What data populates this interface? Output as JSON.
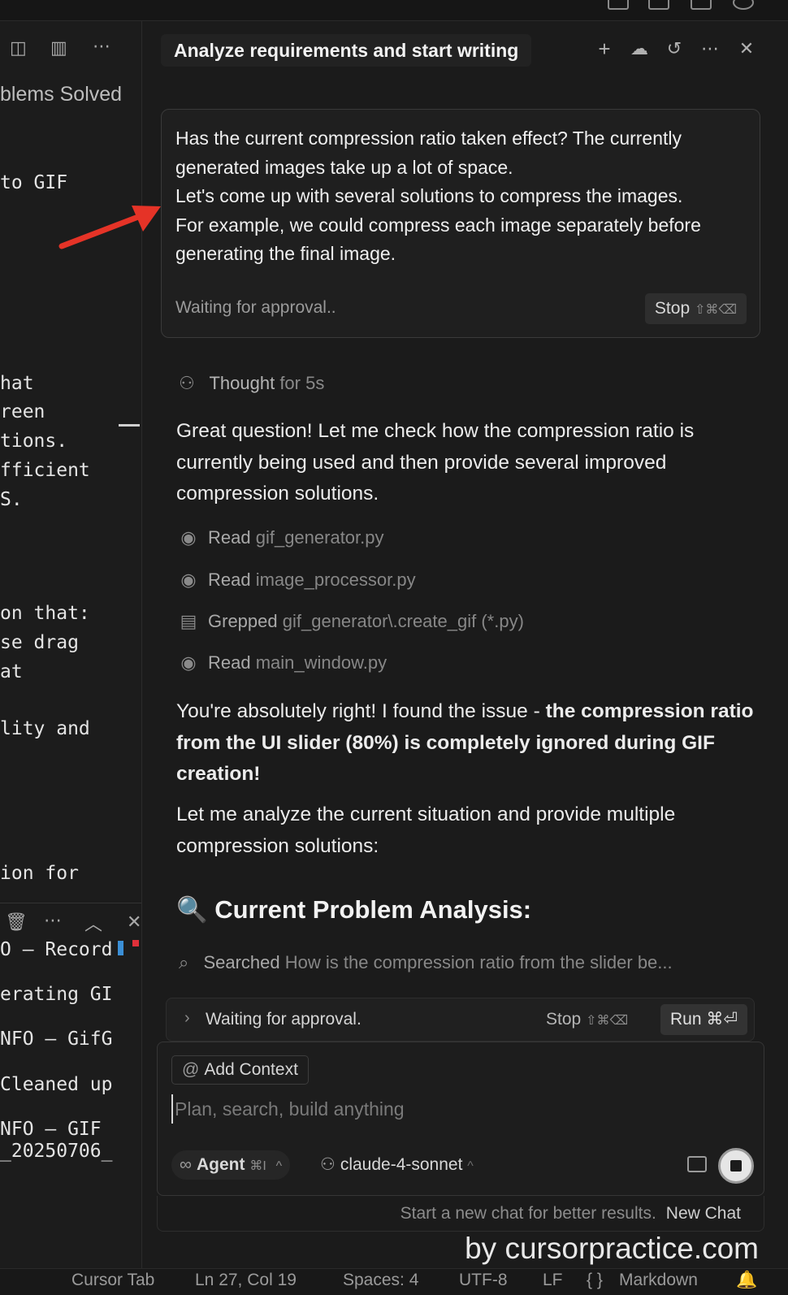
{
  "left": {
    "section_title": "blems Solved",
    "code_lines": [
      "to GIF",
      "hat",
      "reen",
      "tions.",
      "fficient",
      "S.",
      "on that:",
      "se drag",
      "at",
      "lity and",
      "ion for"
    ],
    "terminal_lines": [
      "O – Record",
      "erating GI",
      "NFO – GifG",
      "Cleaned up",
      "NFO – GIF",
      "_20250706_"
    ]
  },
  "header": {
    "title": "Analyze requirements and start writing"
  },
  "user_message": {
    "text_lines": [
      "Has the current compression ratio taken effect? The currently",
      "generated images take up a lot of space.",
      "Let's come up with several solutions to compress the images.",
      "For example, we could compress each image separately before",
      "generating the final image."
    ],
    "waiting": "Waiting for approval..",
    "stop_label": "Stop",
    "stop_shortcut": "⇧⌘⌫"
  },
  "assistant": {
    "thought_label": "Thought",
    "thought_duration": "for 5s",
    "intro": "Great question! Let me check how the compression ratio is currently being used and then provide several improved compression solutions.",
    "tools": [
      {
        "action": "Read",
        "target": "gif_generator.py",
        "icon": "eye-icon"
      },
      {
        "action": "Read",
        "target": "image_processor.py",
        "icon": "eye-icon"
      },
      {
        "action": "Grepped",
        "target": "gif_generator\\.create_gif (*.py)",
        "icon": "grep-icon"
      },
      {
        "action": "Read",
        "target": "main_window.py",
        "icon": "eye-icon"
      }
    ],
    "finding_prefix": "You're absolutely right! I found the issue - ",
    "finding_bold": "the compression ratio from the UI slider (80%) is completely ignored during GIF creation!",
    "analysis_intro": "Let me analyze the current situation and provide multiple compression solutions:",
    "heading_emoji": "🔍",
    "heading": "Current Problem Analysis:",
    "search_action": "Searched",
    "search_query": "How is the compression ratio from the slider be..."
  },
  "approval": {
    "text": "Waiting for approval.",
    "stop_label": "Stop",
    "stop_shortcut": "⇧⌘⌫",
    "run_label": "Run",
    "run_shortcut": "⌘⏎"
  },
  "composer": {
    "add_context": "Add Context",
    "placeholder": "Plan, search, build anything",
    "agent_label": "Agent",
    "agent_shortcut": "⌘I",
    "model": "claude-4-sonnet",
    "footer_note": "Start a new chat for better results.",
    "new_chat": "New Chat"
  },
  "statusbar": {
    "cursor_tab": "Cursor Tab",
    "position": "Ln 27, Col 19",
    "spaces": "Spaces: 4",
    "encoding": "UTF-8",
    "eol": "LF",
    "language": "Markdown"
  },
  "watermark": "by cursorpractice.com",
  "colors": {
    "background": "#1b1b1b",
    "arrow": "#e53327"
  }
}
